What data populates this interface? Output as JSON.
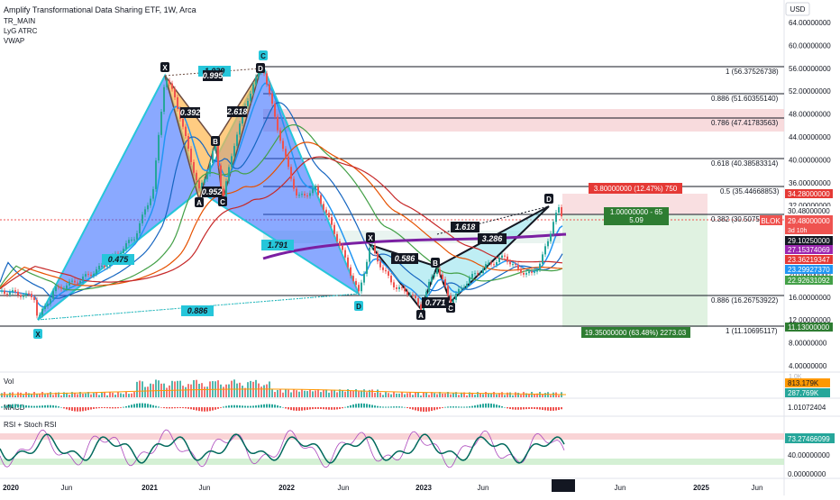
{
  "header": {
    "title": "Amplify Transformational Data Sharing ETF, 1W, Arca",
    "indicators": [
      "TR_MAIN",
      "LyG ATRC",
      "VWAP"
    ],
    "currency": "USD"
  },
  "price_axis": {
    "ticks": [
      "64.00000000",
      "60.00000000",
      "56.00000000",
      "52.00000000",
      "48.00000000",
      "44.00000000",
      "40.00000000",
      "36.00000000",
      "32.00000000",
      "28.00000000",
      "24.00000000",
      "20.00000000",
      "16.00000000",
      "12.00000000",
      "8.00000000",
      "4.00000000"
    ],
    "tags": [
      {
        "text": "34.28000000",
        "bg": "#e53935",
        "fg": "#ffffff"
      },
      {
        "text": "30.48000000",
        "bg": "#ffffff",
        "fg": "#131722"
      },
      {
        "text": "29.48000000",
        "bg": "#ef5350",
        "fg": "#ffffff"
      },
      {
        "text": "3d 10h",
        "bg": "#ef5350",
        "fg": "#ffffff"
      },
      {
        "text": "29.10250000",
        "bg": "#131722",
        "fg": "#ffffff"
      },
      {
        "text": "27.15374069",
        "bg": "#9c27b0",
        "fg": "#ffffff"
      },
      {
        "text": "23.36219347",
        "bg": "#e53935",
        "fg": "#ffffff"
      },
      {
        "text": "23.29927370",
        "bg": "#2196f3",
        "fg": "#ffffff"
      },
      {
        "text": "22.92631092",
        "bg": "#43a047",
        "fg": "#ffffff"
      },
      {
        "text": "11.13000000",
        "bg": "#2e7d32",
        "fg": "#ffffff"
      }
    ],
    "symbol_tag": "BLOK"
  },
  "fib_levels": [
    {
      "label": "1 (56.37526738)"
    },
    {
      "label": "0.886 (51.60355140)"
    },
    {
      "label": "0.786 (47.41783563)"
    },
    {
      "label": "0.618 (40.38583314)"
    },
    {
      "label": "0.5 (35.44668853)"
    },
    {
      "label": "0.382 (30.50753)"
    },
    {
      "label": "0.886 (16.26753922)"
    },
    {
      "label": "1 (11.10695117)"
    }
  ],
  "patterns": {
    "bat": {
      "points": [
        "X",
        "A",
        "B",
        "C",
        "D"
      ],
      "ratios": [
        "0.475",
        "1.791",
        "0.886"
      ]
    },
    "gartley": {
      "points": [
        "X",
        "A",
        "B",
        "C",
        "D"
      ],
      "ratios": [
        "1.039",
        "0.995",
        "0.392",
        "2.618",
        "0.952"
      ]
    },
    "bear_bat": {
      "points": [
        "X",
        "A",
        "B",
        "C",
        "D"
      ],
      "ratios": [
        "0.586",
        "0.771",
        "3.286",
        "1.618"
      ]
    }
  },
  "position": {
    "stop": "3.80000000 (12.47%) 750",
    "center": "1.00000000 - 65",
    "center2": "5.09",
    "target": "19.35000000 (63.48%) 2273.03"
  },
  "volume": {
    "label": "Vol",
    "tags": [
      {
        "text": "813.179K",
        "bg": "#ff9800",
        "fg": "#131722"
      },
      {
        "text": "287.769K",
        "bg": "#26a69a",
        "fg": "#ffffff"
      }
    ],
    "faint_tag": "1.0K"
  },
  "macd": {
    "label": "MACD",
    "tag": "1.01072404"
  },
  "rsi": {
    "label": "RSI + Stoch RSI",
    "tag": "73.27466099",
    "ticks": [
      "40.00000000",
      "0.00000000"
    ]
  },
  "time_axis": [
    "2020",
    "Jun",
    "2021",
    "Jun",
    "2022",
    "Jun",
    "2023",
    "Jun",
    "2024",
    "Jun",
    "2025",
    "Jun"
  ],
  "colors": {
    "up": "#26a69a",
    "down": "#ef5350",
    "blue": "#2196f3",
    "purple": "#7b1fa2"
  }
}
